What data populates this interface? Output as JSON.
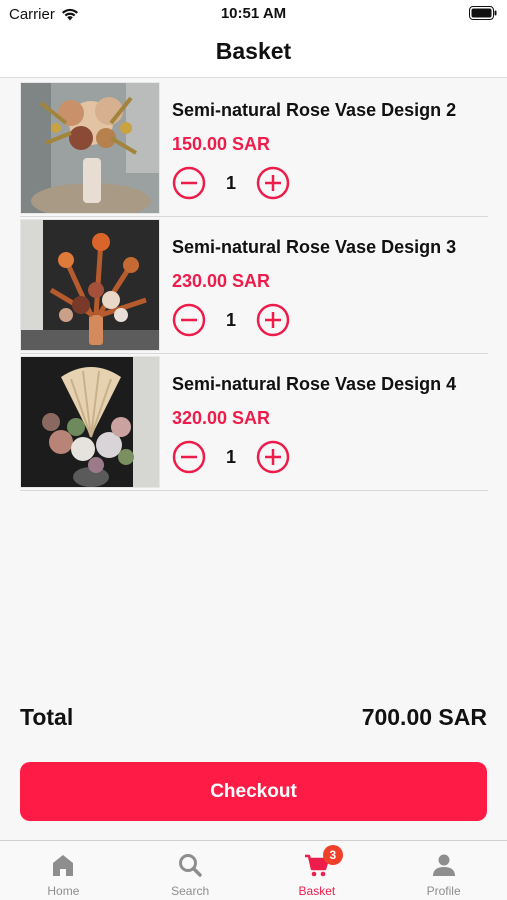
{
  "status_bar": {
    "carrier": "Carrier",
    "time": "10:51 AM"
  },
  "header": {
    "title": "Basket"
  },
  "items": [
    {
      "name": "Semi-natural Rose Vase Design 2",
      "price": "150.00 SAR",
      "qty": "1"
    },
    {
      "name": "Semi-natural Rose Vase Design 3",
      "price": "230.00 SAR",
      "qty": "1"
    },
    {
      "name": "Semi-natural Rose Vase Design 4",
      "price": "320.00 SAR",
      "qty": "1"
    }
  ],
  "summary": {
    "total_label": "Total",
    "total_value": "700.00 SAR"
  },
  "checkout_label": "Checkout",
  "tabs": [
    {
      "label": "Home",
      "icon": "home-icon"
    },
    {
      "label": "Search",
      "icon": "search-icon"
    },
    {
      "label": "Basket",
      "icon": "cart-icon",
      "badge": "3",
      "active": true
    },
    {
      "label": "Profile",
      "icon": "profile-icon"
    }
  ],
  "colors": {
    "accent": "#fe1c47",
    "price": "#ee1c4a",
    "badge": "#f0402a",
    "inactive": "#8e8e8e"
  }
}
